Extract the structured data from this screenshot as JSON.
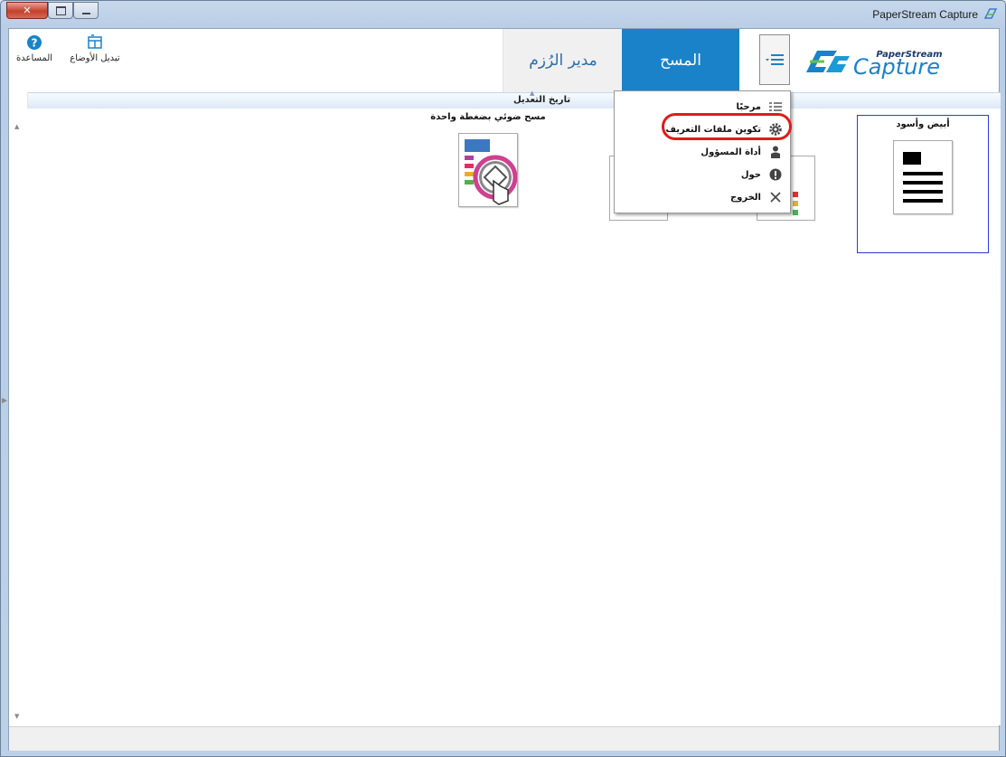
{
  "window": {
    "title": "PaperStream Capture"
  },
  "toolbar": {
    "help_label": "المساعدة",
    "switch_mode_label": "تبديل الأوضاع"
  },
  "tabs": {
    "bundle_manager": "مدير الرُزم",
    "scan": "المسح"
  },
  "logo": {
    "small": "PaperStream",
    "large": "Capture"
  },
  "column_header": {
    "sort_label": "تاريخ التعديل"
  },
  "profiles": [
    {
      "name": "أبيض وأسود",
      "selected": true
    },
    {
      "name": "مسح ضوئي بضغطة واحدة",
      "selected": false
    }
  ],
  "menu": {
    "items": [
      {
        "label": "مرحبًا",
        "icon": "list-icon"
      },
      {
        "label": "تكوين ملفات التعريف",
        "icon": "gear-icon"
      },
      {
        "label": "أداة المسؤول",
        "icon": "person-icon"
      },
      {
        "label": "حول",
        "icon": "info-icon"
      },
      {
        "label": "الخروج",
        "icon": "close-icon"
      }
    ]
  },
  "colors": {
    "scan_tab": "#1a82c9",
    "bundle_text": "#2d6ea8",
    "highlight": "#e11b1b",
    "selection": "#2b3bd6"
  }
}
